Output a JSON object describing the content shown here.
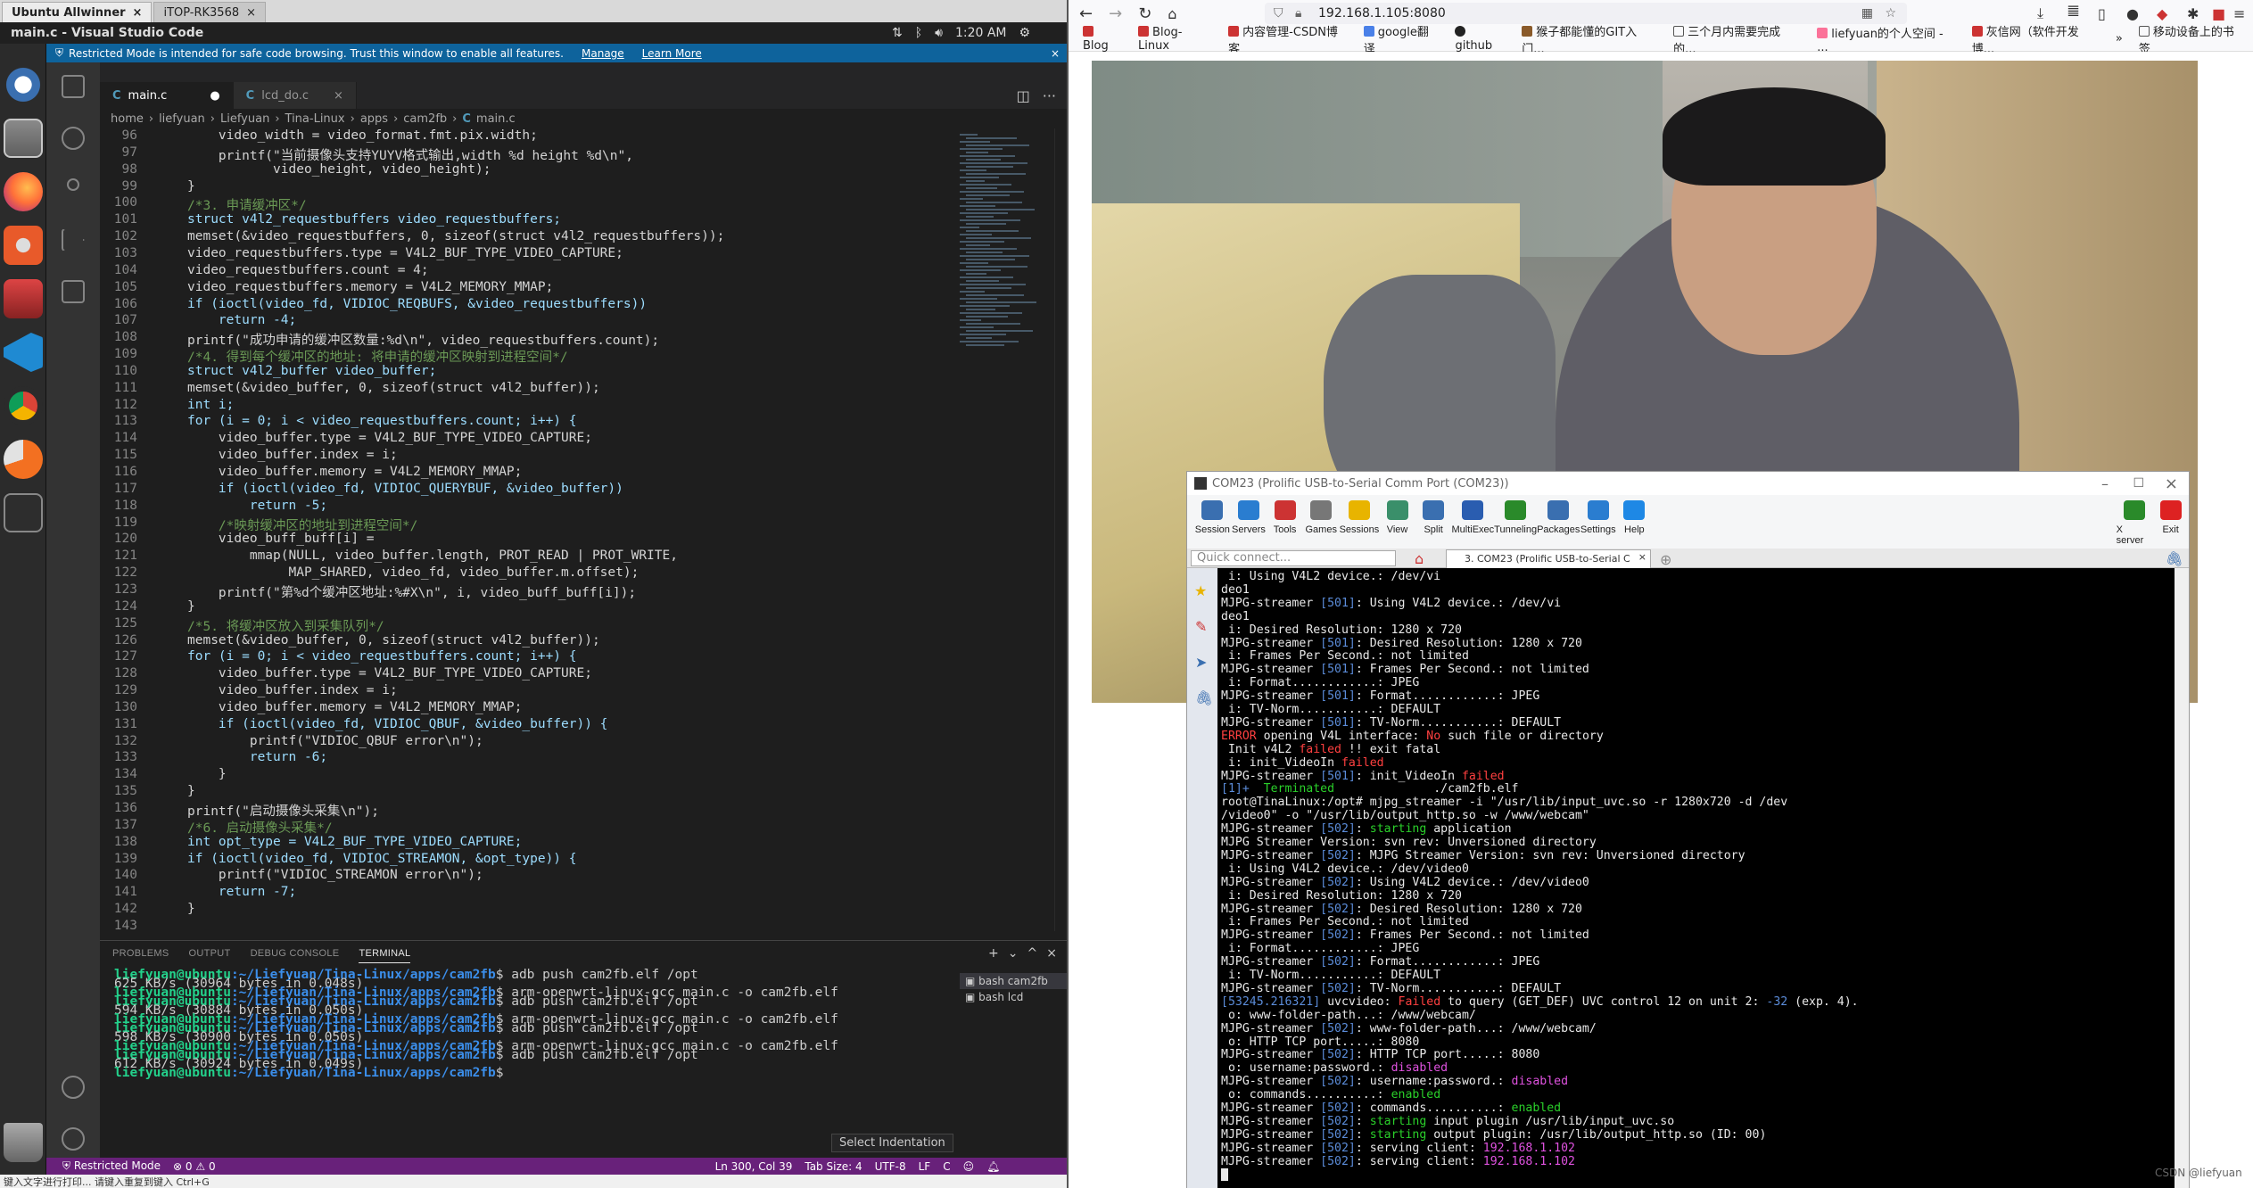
{
  "vm_tabs": [
    {
      "label": "Ubuntu Allwinner"
    },
    {
      "label": "iTOP-RK3568"
    }
  ],
  "topbar": {
    "title": "main.c - Visual Studio Code",
    "time": "1:20 AM"
  },
  "restricted_bar": {
    "text": "Restricted Mode is intended for safe code browsing. Trust this window to enable all features.",
    "manage": "Manage",
    "learn_more": "Learn More"
  },
  "editor_tabs": [
    {
      "icon": "C",
      "label": "main.c",
      "dirty": "●"
    },
    {
      "icon": "C",
      "label": "lcd_do.c",
      "close": "×"
    }
  ],
  "breadcrumb": [
    "home",
    "liefyuan",
    "Liefyuan",
    "Tina-Linux",
    "apps",
    "cam2fb",
    "C",
    "main.c"
  ],
  "code_lines": [
    {
      "n": "96",
      "t": "    video_width = video_format.fmt.pix.width;"
    },
    {
      "n": "97",
      "t": "    printf(\"当前摄像头支持YUYV格式输出,width %d height %d\\n\","
    },
    {
      "n": "98",
      "t": "           video_height, video_height);"
    },
    {
      "n": "99",
      "t": "}"
    },
    {
      "n": "100",
      "t": "/*3. 申请缓冲区*/"
    },
    {
      "n": "101",
      "t": "struct v4l2_requestbuffers video_requestbuffers;"
    },
    {
      "n": "102",
      "t": "memset(&video_requestbuffers, 0, sizeof(struct v4l2_requestbuffers));"
    },
    {
      "n": "103",
      "t": "video_requestbuffers.type = V4L2_BUF_TYPE_VIDEO_CAPTURE;"
    },
    {
      "n": "104",
      "t": "video_requestbuffers.count = 4;"
    },
    {
      "n": "105",
      "t": "video_requestbuffers.memory = V4L2_MEMORY_MMAP;"
    },
    {
      "n": "106",
      "t": "if (ioctl(video_fd, VIDIOC_REQBUFS, &video_requestbuffers))"
    },
    {
      "n": "107",
      "t": "    return -4;"
    },
    {
      "n": "108",
      "t": "printf(\"成功申请的缓冲区数量:%d\\n\", video_requestbuffers.count);"
    },
    {
      "n": "109",
      "t": "/*4. 得到每个缓冲区的地址: 将申请的缓冲区映射到进程空间*/"
    },
    {
      "n": "110",
      "t": "struct v4l2_buffer video_buffer;"
    },
    {
      "n": "111",
      "t": "memset(&video_buffer, 0, sizeof(struct v4l2_buffer));"
    },
    {
      "n": "112",
      "t": "int i;"
    },
    {
      "n": "113",
      "t": "for (i = 0; i < video_requestbuffers.count; i++) {"
    },
    {
      "n": "114",
      "t": "    video_buffer.type = V4L2_BUF_TYPE_VIDEO_CAPTURE;"
    },
    {
      "n": "115",
      "t": "    video_buffer.index = i;"
    },
    {
      "n": "116",
      "t": "    video_buffer.memory = V4L2_MEMORY_MMAP;"
    },
    {
      "n": "117",
      "t": "    if (ioctl(video_fd, VIDIOC_QUERYBUF, &video_buffer))"
    },
    {
      "n": "118",
      "t": "        return -5;"
    },
    {
      "n": "119",
      "t": "    /*映射缓冲区的地址到进程空间*/"
    },
    {
      "n": "120",
      "t": "    video_buff_buff[i] ="
    },
    {
      "n": "121",
      "t": "        mmap(NULL, video_buffer.length, PROT_READ | PROT_WRITE,"
    },
    {
      "n": "122",
      "t": "             MAP_SHARED, video_fd, video_buffer.m.offset);"
    },
    {
      "n": "123",
      "t": "    printf(\"第%d个缓冲区地址:%#X\\n\", i, video_buff_buff[i]);"
    },
    {
      "n": "124",
      "t": "}"
    },
    {
      "n": "125",
      "t": "/*5. 将缓冲区放入到采集队列*/"
    },
    {
      "n": "126",
      "t": "memset(&video_buffer, 0, sizeof(struct v4l2_buffer));"
    },
    {
      "n": "127",
      "t": "for (i = 0; i < video_requestbuffers.count; i++) {"
    },
    {
      "n": "128",
      "t": "    video_buffer.type = V4L2_BUF_TYPE_VIDEO_CAPTURE;"
    },
    {
      "n": "129",
      "t": "    video_buffer.index = i;"
    },
    {
      "n": "130",
      "t": "    video_buffer.memory = V4L2_MEMORY_MMAP;"
    },
    {
      "n": "131",
      "t": "    if (ioctl(video_fd, VIDIOC_QBUF, &video_buffer)) {"
    },
    {
      "n": "132",
      "t": "        printf(\"VIDIOC_QBUF error\\n\");"
    },
    {
      "n": "133",
      "t": "        return -6;"
    },
    {
      "n": "134",
      "t": "    }"
    },
    {
      "n": "135",
      "t": "}"
    },
    {
      "n": "136",
      "t": "printf(\"启动摄像头采集\\n\");"
    },
    {
      "n": "137",
      "t": "/*6. 启动摄像头采集*/"
    },
    {
      "n": "138",
      "t": "int opt_type = V4L2_BUF_TYPE_VIDEO_CAPTURE;"
    },
    {
      "n": "139",
      "t": "if (ioctl(video_fd, VIDIOC_STREAMON, &opt_type)) {"
    },
    {
      "n": "140",
      "t": "    printf(\"VIDIOC_STREAMON error\\n\");"
    },
    {
      "n": "141",
      "t": "    return -7;"
    },
    {
      "n": "142",
      "t": "}"
    },
    {
      "n": "143",
      "t": ""
    }
  ],
  "panel_tabs": [
    "PROBLEMS",
    "OUTPUT",
    "DEBUG CONSOLE",
    "TERMINAL"
  ],
  "terminal_sessions": [
    "bash  cam2fb",
    "bash  lcd"
  ],
  "terminal_prompt_user": "liefyuan@ubuntu",
  "terminal_prompt_path": ":~/Liefyuan/Tina-Linux/apps/cam2fb",
  "terminal_lines": [
    {
      "kind": "cmd",
      "t": "$ adb push cam2fb.elf /opt"
    },
    {
      "kind": "out",
      "t": "625 KB/s (30964 bytes in 0.048s)"
    },
    {
      "kind": "cmd",
      "t": "$ arm-openwrt-linux-gcc main.c -o cam2fb.elf"
    },
    {
      "kind": "cmd",
      "t": "$ adb push cam2fb.elf /opt"
    },
    {
      "kind": "out",
      "t": "594 KB/s (30884 bytes in 0.050s)"
    },
    {
      "kind": "cmd",
      "t": "$ arm-openwrt-linux-gcc main.c -o cam2fb.elf"
    },
    {
      "kind": "cmd",
      "t": "$ adb push cam2fb.elf /opt"
    },
    {
      "kind": "out",
      "t": "598 KB/s (30900 bytes in 0.050s)"
    },
    {
      "kind": "cmd",
      "t": "$ arm-openwrt-linux-gcc main.c -o cam2fb.elf"
    },
    {
      "kind": "cmd",
      "t": "$ adb push cam2fb.elf /opt"
    },
    {
      "kind": "out",
      "t": "612 KB/s (30924 bytes in 0.049s)"
    },
    {
      "kind": "cmd",
      "t": "$ "
    }
  ],
  "select_indentation": "Select Indentation",
  "status": {
    "restricted": "Restricted Mode",
    "problems": "⊗ 0 ⚠ 0",
    "pos": "Ln 300, Col 39",
    "tab": "Tab Size: 4",
    "enc": "UTF-8",
    "eol": "LF",
    "lang": "C"
  },
  "taskbar_text": "键入文字进行打印...  请键入重复到键入 Ctrl+G",
  "browser": {
    "url": "192.168.1.105:8080"
  },
  "bookmarks": [
    "Blog",
    "Blog-Linux",
    "内容管理-CSDN博客",
    "google翻译",
    "github",
    "猴子都能懂的GIT入门...",
    "三个月内需要完成的...",
    "liefyuan的个人空间 - ...",
    "灰信网（软件开发博...",
    "移动设备上的书签"
  ],
  "mobaxterm": {
    "title": "COM23  (Prolific USB-to-Serial Comm Port (COM23))",
    "toolbar": [
      "Session",
      "Servers",
      "Tools",
      "Games",
      "Sessions",
      "View",
      "Split",
      "MultiExec",
      "Tunneling",
      "Packages",
      "Settings",
      "Help",
      "X server",
      "Exit"
    ],
    "quick_connect": "Quick connect...",
    "tab_label": "3. COM23  (Prolific USB-to-Serial C"
  },
  "serial_lines": [
    [
      {
        "t": " i: Using V4L2 device.: /dev/vi"
      }
    ],
    [
      {
        "t": "deo1"
      }
    ],
    [
      {
        "t": "MJPG-streamer "
      },
      {
        "t": "[501]",
        "c": "bl"
      },
      {
        "t": ": Using V4L2 device.: /dev/vi"
      }
    ],
    [
      {
        "t": "deo1"
      }
    ],
    [
      {
        "t": " i: Desired Resolution: 1280 x 720"
      }
    ],
    [
      {
        "t": "MJPG-streamer "
      },
      {
        "t": "[501]",
        "c": "bl"
      },
      {
        "t": ": Desired Resolution: 1280 x 720"
      }
    ],
    [
      {
        "t": " i: Frames Per Second.: not limited"
      }
    ],
    [
      {
        "t": "MJPG-streamer "
      },
      {
        "t": "[501]",
        "c": "bl"
      },
      {
        "t": ": Frames Per Second.: not limited"
      }
    ],
    [
      {
        "t": " i: Format............: JPEG"
      }
    ],
    [
      {
        "t": "MJPG-streamer "
      },
      {
        "t": "[501]",
        "c": "bl"
      },
      {
        "t": ": Format............: JPEG"
      }
    ],
    [
      {
        "t": " i: TV-Norm...........: DEFAULT"
      }
    ],
    [
      {
        "t": "MJPG-streamer "
      },
      {
        "t": "[501]",
        "c": "bl"
      },
      {
        "t": ": TV-Norm...........: DEFAULT"
      }
    ],
    [
      {
        "t": "ERROR",
        "c": "rd"
      },
      {
        "t": " opening V4L interface: "
      },
      {
        "t": "No",
        "c": "rd"
      },
      {
        "t": " such file or directory"
      }
    ],
    [
      {
        "t": " Init v4L2 "
      },
      {
        "t": "failed",
        "c": "rd"
      },
      {
        "t": " !! exit fatal"
      }
    ],
    [
      {
        "t": " i: init_VideoIn "
      },
      {
        "t": "failed",
        "c": "rd"
      }
    ],
    [
      {
        "t": "MJPG-streamer "
      },
      {
        "t": "[501]",
        "c": "bl"
      },
      {
        "t": ": init_VideoIn "
      },
      {
        "t": "failed",
        "c": "rd"
      }
    ],
    [
      {
        "t": "[1]+  ",
        "c": "bl"
      },
      {
        "t": "Terminated",
        "c": "gr"
      },
      {
        "t": "              ./cam2fb.elf"
      }
    ],
    [
      {
        "t": "root@TinaLinux:/opt# mjpg_streamer -i \"/usr/lib/input_uvc.so -r 1280x720 -d /dev"
      }
    ],
    [
      {
        "t": "/video0\" -o \"/usr/lib/output_http.so -w /www/webcam\""
      }
    ],
    [
      {
        "t": "MJPG-streamer "
      },
      {
        "t": "[502]",
        "c": "bl"
      },
      {
        "t": ": "
      },
      {
        "t": "starting",
        "c": "gr"
      },
      {
        "t": " application"
      }
    ],
    [
      {
        "t": "MJPG Streamer Version: svn rev: Unversioned directory"
      }
    ],
    [
      {
        "t": "MJPG-streamer "
      },
      {
        "t": "[502]",
        "c": "bl"
      },
      {
        "t": ": MJPG Streamer Version: svn rev: Unversioned directory"
      }
    ],
    [
      {
        "t": " i: Using V4L2 device.: /dev/video0"
      }
    ],
    [
      {
        "t": "MJPG-streamer "
      },
      {
        "t": "[502]",
        "c": "bl"
      },
      {
        "t": ": Using V4L2 device.: /dev/video0"
      }
    ],
    [
      {
        "t": " i: Desired Resolution: 1280 x 720"
      }
    ],
    [
      {
        "t": "MJPG-streamer "
      },
      {
        "t": "[502]",
        "c": "bl"
      },
      {
        "t": ": Desired Resolution: 1280 x 720"
      }
    ],
    [
      {
        "t": " i: Frames Per Second.: not limited"
      }
    ],
    [
      {
        "t": "MJPG-streamer "
      },
      {
        "t": "[502]",
        "c": "bl"
      },
      {
        "t": ": Frames Per Second.: not limited"
      }
    ],
    [
      {
        "t": " i: Format............: JPEG"
      }
    ],
    [
      {
        "t": "MJPG-streamer "
      },
      {
        "t": "[502]",
        "c": "bl"
      },
      {
        "t": ": Format............: JPEG"
      }
    ],
    [
      {
        "t": " i: TV-Norm...........: DEFAULT"
      }
    ],
    [
      {
        "t": "MJPG-streamer "
      },
      {
        "t": "[502]",
        "c": "bl"
      },
      {
        "t": ": TV-Norm...........: DEFAULT"
      }
    ],
    [
      {
        "t": "[53245.216321]",
        "c": "bl"
      },
      {
        "t": " uvcvideo: "
      },
      {
        "t": "Failed",
        "c": "rd"
      },
      {
        "t": " to query (GET_DEF) UVC control 12 on unit 2: "
      },
      {
        "t": "-32",
        "c": "bl"
      },
      {
        "t": " (exp. 4)."
      }
    ],
    [
      {
        "t": " o: www-folder-path...: /www/webcam/"
      }
    ],
    [
      {
        "t": "MJPG-streamer "
      },
      {
        "t": "[502]",
        "c": "bl"
      },
      {
        "t": ": www-folder-path...: /www/webcam/"
      }
    ],
    [
      {
        "t": " o: HTTP TCP port.....: 8080"
      }
    ],
    [
      {
        "t": "MJPG-streamer "
      },
      {
        "t": "[502]",
        "c": "bl"
      },
      {
        "t": ": HTTP TCP port.....: 8080"
      }
    ],
    [
      {
        "t": " o: username:password.: "
      },
      {
        "t": "disabled",
        "c": "mg"
      }
    ],
    [
      {
        "t": "MJPG-streamer "
      },
      {
        "t": "[502]",
        "c": "bl"
      },
      {
        "t": ": username:password.: "
      },
      {
        "t": "disabled",
        "c": "mg"
      }
    ],
    [
      {
        "t": " o: commands..........: "
      },
      {
        "t": "enabled",
        "c": "gr"
      }
    ],
    [
      {
        "t": "MJPG-streamer "
      },
      {
        "t": "[502]",
        "c": "bl"
      },
      {
        "t": ": commands..........: "
      },
      {
        "t": "enabled",
        "c": "gr"
      }
    ],
    [
      {
        "t": "MJPG-streamer "
      },
      {
        "t": "[502]",
        "c": "bl"
      },
      {
        "t": ": "
      },
      {
        "t": "starting",
        "c": "gr"
      },
      {
        "t": " input plugin /usr/lib/input_uvc.so"
      }
    ],
    [
      {
        "t": "MJPG-streamer "
      },
      {
        "t": "[502]",
        "c": "bl"
      },
      {
        "t": ": "
      },
      {
        "t": "starting",
        "c": "gr"
      },
      {
        "t": " output plugin: /usr/lib/output_http.so (ID: 00)"
      }
    ],
    [
      {
        "t": "MJPG-streamer "
      },
      {
        "t": "[502]",
        "c": "bl"
      },
      {
        "t": ": serving client: "
      },
      {
        "t": "192.168.1.102",
        "c": "mg"
      }
    ],
    [
      {
        "t": "MJPG-streamer "
      },
      {
        "t": "[502]",
        "c": "bl"
      },
      {
        "t": ": serving client: "
      },
      {
        "t": "192.168.1.102",
        "c": "mg"
      }
    ]
  ],
  "watermark": "CSDN @liefyuan",
  "colors": {
    "accent_blue": "#0e639c",
    "restricted_status": "#68217a",
    "firefox_accent": "#ff7139"
  }
}
